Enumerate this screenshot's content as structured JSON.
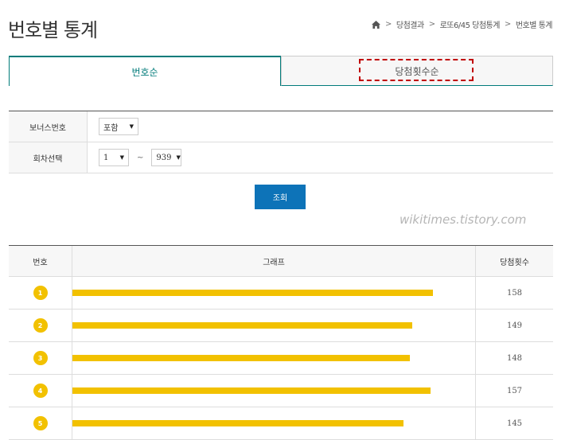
{
  "header": {
    "title": "번호별 통계",
    "breadcrumb": [
      "당첨결과",
      "로또6/45 당첨통계",
      "번호별 통계"
    ]
  },
  "tabs": [
    {
      "label": "번호순",
      "active": true
    },
    {
      "label": "당첨횟수순",
      "active": false
    }
  ],
  "filters": {
    "bonus_label": "보너스번호",
    "bonus_value": "포함",
    "round_label": "회차선택",
    "round_from": "1",
    "round_to": "939",
    "separator": "~"
  },
  "search_button": "조회",
  "watermark": "wikitimes.tistory.com",
  "table": {
    "headers": [
      "번호",
      "그래프",
      "당첨횟수"
    ],
    "max_count": 158,
    "rows": [
      {
        "number": "1",
        "count": 158
      },
      {
        "number": "2",
        "count": 149
      },
      {
        "number": "3",
        "count": 148
      },
      {
        "number": "4",
        "count": 157
      },
      {
        "number": "5",
        "count": 145
      }
    ]
  },
  "colors": {
    "accent": "#007b7a",
    "button": "#0d73b8",
    "ball": "#f2c100",
    "highlight": "#c00000"
  }
}
